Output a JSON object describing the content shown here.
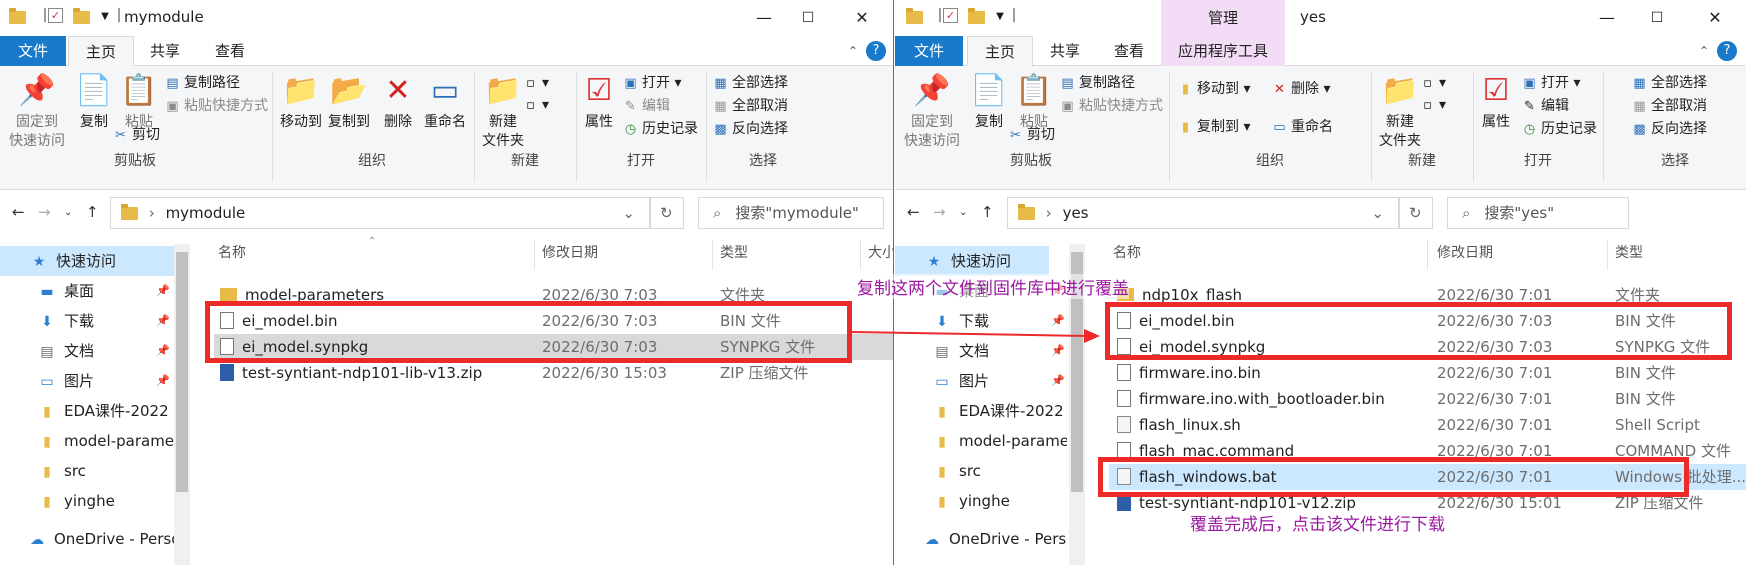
{
  "left": {
    "title": "mymodule",
    "tabs": {
      "file": "文件",
      "home": "主页",
      "share": "共享",
      "view": "查看"
    },
    "ribbon": {
      "pin": "固定到\n快速访问",
      "copy": "复制",
      "paste": "粘贴",
      "copy_path": "复制路径",
      "paste_shortcut": "粘贴快捷方式",
      "cut": "剪切",
      "clipboard": "剪贴板",
      "move_to": "移动到",
      "copy_to": "复制到",
      "delete": "删除",
      "rename": "重命名",
      "organize": "组织",
      "new_folder": "新建\n文件夹",
      "new": "新建",
      "properties": "属性",
      "open": "打开",
      "edit": "编辑",
      "history": "历史记录",
      "open_group": "打开",
      "select_all": "全部选择",
      "select_none": "全部取消",
      "invert": "反向选择",
      "select_group": "选择"
    },
    "address": "mymodule",
    "search_placeholder": "搜索\"mymodule\"",
    "columns": {
      "name": "名称",
      "date": "修改日期",
      "type": "类型",
      "size": "大小"
    },
    "nav": [
      {
        "label": "快速访问",
        "icon": "star-icon"
      },
      {
        "label": "桌面",
        "icon": "desktop-icon"
      },
      {
        "label": "下载",
        "icon": "download-icon"
      },
      {
        "label": "文档",
        "icon": "document-icon"
      },
      {
        "label": "图片",
        "icon": "picture-icon"
      },
      {
        "label": "EDA课件-2022",
        "icon": "folder-icon"
      },
      {
        "label": "model-parame",
        "icon": "folder-icon"
      },
      {
        "label": "src",
        "icon": "folder-icon"
      },
      {
        "label": "yinghe",
        "icon": "folder-icon"
      },
      {
        "label": "OneDrive - Perso",
        "icon": "cloud-icon"
      }
    ],
    "files": [
      {
        "name": "model-parameters",
        "date": "2022/6/30 7:03",
        "type": "文件夹",
        "icon": "folder"
      },
      {
        "name": "ei_model.bin",
        "date": "2022/6/30 7:03",
        "type": "BIN 文件",
        "icon": "file"
      },
      {
        "name": "ei_model.synpkg",
        "date": "2022/6/30 7:03",
        "type": "SYNPKG 文件",
        "icon": "file"
      },
      {
        "name": "test-syntiant-ndp101-lib-v13.zip",
        "date": "2022/6/30 15:03",
        "type": "ZIP 压缩文件",
        "icon": "zip"
      }
    ]
  },
  "right": {
    "title": "yes",
    "context_tab": "管理",
    "tabs": {
      "file": "文件",
      "home": "主页",
      "share": "共享",
      "view": "查看",
      "app_tools": "应用程序工具"
    },
    "ribbon": {
      "pin": "固定到\n快速访问",
      "copy": "复制",
      "paste": "粘贴",
      "copy_path": "复制路径",
      "paste_shortcut": "粘贴快捷方式",
      "cut": "剪切",
      "clipboard": "剪贴板",
      "move_to": "移动到",
      "copy_to": "复制到",
      "delete": "删除",
      "rename": "重命名",
      "organize": "组织",
      "new_folder": "新建\n文件夹",
      "new": "新建",
      "properties": "属性",
      "open": "打开",
      "edit": "编辑",
      "history": "历史记录",
      "open_group": "打开",
      "select_all": "全部选择",
      "select_none": "全部取消",
      "invert": "反向选择",
      "select_group": "选择"
    },
    "address": "yes",
    "search_placeholder": "搜索\"yes\"",
    "columns": {
      "name": "名称",
      "date": "修改日期",
      "type": "类型"
    },
    "nav": [
      {
        "label": "快速访问",
        "icon": "star-icon"
      },
      {
        "label": "桌面",
        "icon": "desktop-icon"
      },
      {
        "label": "下载",
        "icon": "download-icon"
      },
      {
        "label": "文档",
        "icon": "document-icon"
      },
      {
        "label": "图片",
        "icon": "picture-icon"
      },
      {
        "label": "EDA课件-2022",
        "icon": "folder-icon"
      },
      {
        "label": "model-parame",
        "icon": "folder-icon"
      },
      {
        "label": "src",
        "icon": "folder-icon"
      },
      {
        "label": "yinghe",
        "icon": "folder-icon"
      },
      {
        "label": "OneDrive - Perso",
        "icon": "cloud-icon"
      }
    ],
    "files": [
      {
        "name": "ndp10x_flash",
        "date": "2022/6/30 7:01",
        "type": "文件夹",
        "icon": "folder"
      },
      {
        "name": "ei_model.bin",
        "date": "2022/6/30 7:03",
        "type": "BIN 文件",
        "icon": "file"
      },
      {
        "name": "ei_model.synpkg",
        "date": "2022/6/30 7:03",
        "type": "SYNPKG 文件",
        "icon": "file"
      },
      {
        "name": "firmware.ino.bin",
        "date": "2022/6/30 7:01",
        "type": "BIN 文件",
        "icon": "file"
      },
      {
        "name": "firmware.ino.with_bootloader.bin",
        "date": "2022/6/30 7:01",
        "type": "BIN 文件",
        "icon": "file"
      },
      {
        "name": "flash_linux.sh",
        "date": "2022/6/30 7:01",
        "type": "Shell Script",
        "icon": "script"
      },
      {
        "name": "flash_mac.command",
        "date": "2022/6/30 7:01",
        "type": "COMMAND 文件",
        "icon": "file"
      },
      {
        "name": "flash_windows.bat",
        "date": "2022/6/30 7:01",
        "type": "Windows 批处理...",
        "icon": "script"
      },
      {
        "name": "test-syntiant-ndp101-v12.zip",
        "date": "2022/6/30 15:01",
        "type": "ZIP 压缩文件",
        "icon": "zip"
      }
    ]
  },
  "annotations": {
    "copy_note": "复制这两个文件到固件库中进行覆盖",
    "download_note": "覆盖完成后，点击该文件进行下载"
  },
  "colors": {
    "file_tab": "#1979ca",
    "highlight_box": "#ec2a2a",
    "annotation_text": "#9b19a0",
    "selected_row": "#cce8ff",
    "context_tab": "#f3dcf5"
  }
}
